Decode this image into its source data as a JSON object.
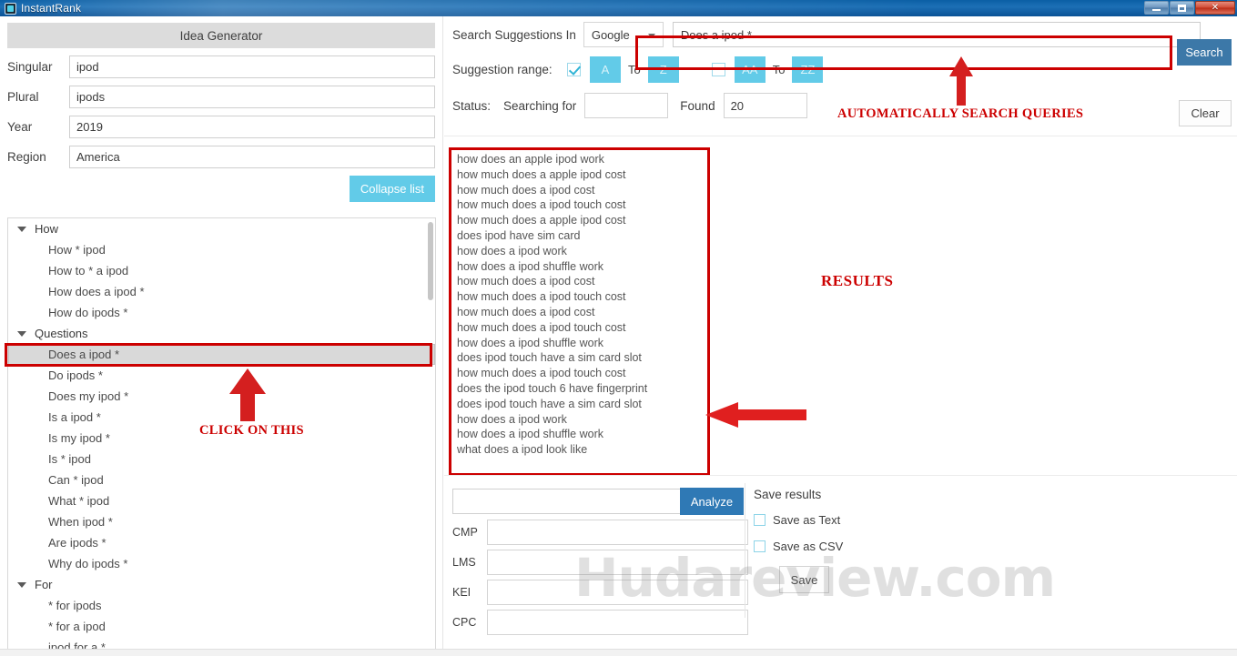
{
  "window": {
    "title": "InstantRank",
    "icon": "app-icon",
    "controls": {
      "minimize": "minimize",
      "maximize": "maximize",
      "close": "✕"
    }
  },
  "left": {
    "header": "Idea Generator",
    "fields": [
      {
        "label": "Singular",
        "value": "ipod"
      },
      {
        "label": "Plural",
        "value": "ipods"
      },
      {
        "label": "Year",
        "value": "2019"
      },
      {
        "label": "Region",
        "value": "America"
      }
    ],
    "collapse_label": "Collapse list",
    "tree": [
      {
        "type": "group",
        "label": "How",
        "expanded": true
      },
      {
        "type": "child",
        "label": "How * ipod"
      },
      {
        "type": "child",
        "label": "How to * a ipod"
      },
      {
        "type": "child",
        "label": "How does a ipod *"
      },
      {
        "type": "child",
        "label": "How do ipods *"
      },
      {
        "type": "group",
        "label": "Questions",
        "expanded": true
      },
      {
        "type": "child",
        "label": "Does a ipod *",
        "selected": true
      },
      {
        "type": "child",
        "label": "Do ipods *"
      },
      {
        "type": "child",
        "label": "Does my ipod *"
      },
      {
        "type": "child",
        "label": "Is a ipod *"
      },
      {
        "type": "child",
        "label": "Is my ipod *"
      },
      {
        "type": "child",
        "label": "Is * ipod"
      },
      {
        "type": "child",
        "label": "Can * ipod"
      },
      {
        "type": "child",
        "label": "What * ipod"
      },
      {
        "type": "child",
        "label": "When ipod *"
      },
      {
        "type": "child",
        "label": "Are ipods *"
      },
      {
        "type": "child",
        "label": "Why do ipods *"
      },
      {
        "type": "group",
        "label": "For",
        "expanded": true
      },
      {
        "type": "child",
        "label": "* for ipods"
      },
      {
        "type": "child",
        "label": "* for a ipod"
      },
      {
        "type": "child",
        "label": "ipod for a *"
      }
    ]
  },
  "top": {
    "search_in_label": "Search Suggestions In",
    "engine": "Google",
    "query": "Does a ipod *",
    "search_button": "Search",
    "clear_button": "Clear",
    "range_label": "Suggestion range:",
    "range_single": {
      "checked": true,
      "from": "A",
      "to_label": "To",
      "to": "Z"
    },
    "range_double": {
      "checked": false,
      "from": "AA",
      "to_label": "To",
      "to": "ZZ"
    },
    "status_label": "Status:",
    "searching_label": "Searching for",
    "searching_value": "",
    "found_label": "Found",
    "found_value": "20"
  },
  "results": [
    "how does an apple ipod work",
    "how much does a apple ipod cost",
    "how much does a ipod cost",
    "how much does a ipod touch cost",
    "how much does a apple ipod cost",
    "does ipod have sim card",
    "how does a ipod work",
    "how does a ipod shuffle work",
    "how much does a ipod cost",
    "how much does a ipod touch cost",
    "how much does a ipod cost",
    "how much does a ipod touch cost",
    "how does a ipod shuffle work",
    "does ipod touch have a sim card slot",
    "how much does a ipod touch cost",
    "does the ipod touch 6 have fingerprint",
    "does ipod touch have a sim card slot",
    "how does a ipod work",
    "how does a ipod shuffle work",
    "what does a ipod look like"
  ],
  "bottom": {
    "analyze_input": "",
    "analyze_button": "Analyze",
    "metrics": [
      {
        "label": "CMP",
        "value": ""
      },
      {
        "label": "LMS",
        "value": ""
      },
      {
        "label": "KEI",
        "value": ""
      },
      {
        "label": "CPC",
        "value": ""
      }
    ],
    "save_results_title": "Save results",
    "save_as_text": {
      "label": "Save as Text",
      "checked": false
    },
    "save_as_csv": {
      "label": "Save as CSV",
      "checked": false
    },
    "save_button": "Save"
  },
  "annotations": {
    "auto_search": "AUTOMATICALLY SEARCH QUERIES",
    "results": "RESULTS",
    "click_on_this": "CLICK ON THIS"
  },
  "watermark": "Hudareview.com",
  "colors": {
    "accent_blue": "#3c78a8",
    "analyze_blue": "#2f79b5",
    "cyan": "#62cbe8",
    "annotation_red": "#cc0000",
    "titlebar_blue": "#0b5fa5"
  }
}
